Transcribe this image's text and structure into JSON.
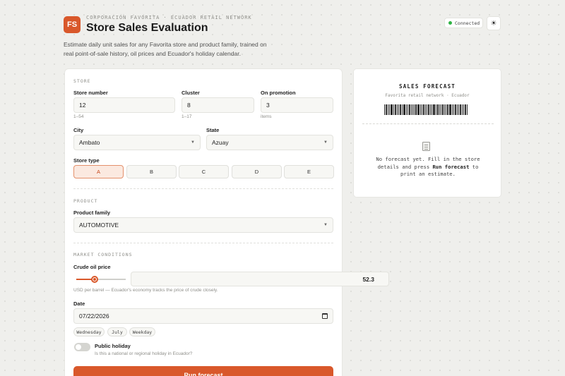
{
  "header": {
    "logo_text": "FS",
    "eyebrow": "CORPORACIÓN FAVORITA · ECUADOR RETAIL NETWORK",
    "title": "Store Sales Evaluation",
    "description": "Estimate daily unit sales for any Favorita store and product family, trained on real point-of-sale history, oil prices and Ecuador's holiday calendar.",
    "status": "Connected",
    "status_color": "#2fb344",
    "theme_icon": "sun-icon",
    "accent_color": "#d9582b"
  },
  "store": {
    "section_label": "STORE",
    "store_number": {
      "label": "Store number",
      "value": "12",
      "hint": "1–54"
    },
    "cluster": {
      "label": "Cluster",
      "value": "8",
      "hint": "1–17"
    },
    "promotion": {
      "label": "On promotion",
      "value": "3",
      "hint": "items"
    },
    "city": {
      "label": "City",
      "value": "Ambato"
    },
    "state": {
      "label": "State",
      "value": "Azuay"
    },
    "store_type": {
      "label": "Store type",
      "options": [
        "A",
        "B",
        "C",
        "D",
        "E"
      ],
      "selected": "A"
    }
  },
  "product": {
    "section_label": "PRODUCT",
    "family": {
      "label": "Product family",
      "value": "AUTOMOTIVE"
    }
  },
  "market": {
    "section_label": "MARKET CONDITIONS",
    "oil": {
      "label": "Crude oil price",
      "value": "52.3",
      "slider_fraction": 0.37,
      "hint": "USD per barrel — Ecuador's economy tracks the price of crude closely."
    },
    "date": {
      "label": "Date",
      "value": "07/22/2026",
      "chips": [
        "Wednesday",
        "July",
        "Weekday"
      ]
    },
    "holiday": {
      "label": "Public holiday",
      "hint": "Is this a national or regional holiday in Ecuador?",
      "checked": false
    }
  },
  "run_button": "Run forecast",
  "forecast": {
    "title": "SALES FORECAST",
    "subtitle": "Favorita retail network · Ecuador",
    "empty_part1": "No forecast yet. Fill in the store details and press ",
    "empty_bold": "Run forecast",
    "empty_part2": " to print an estimate."
  }
}
